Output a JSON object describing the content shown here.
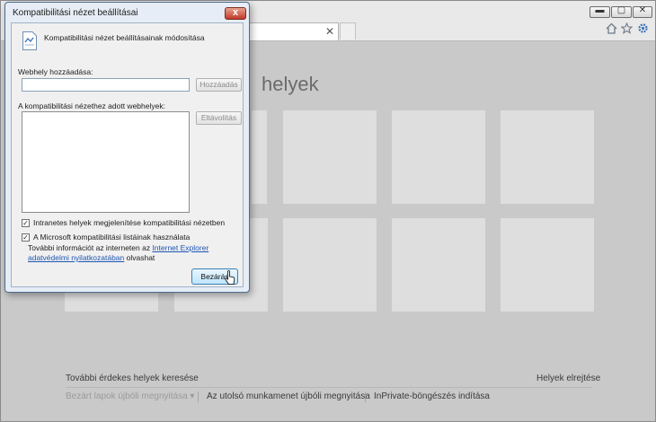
{
  "browser": {
    "window_buttons": {
      "minimize": "▬",
      "maximize": "▢",
      "close": "✕"
    },
    "tab_close": "✕",
    "toolbar_icons": [
      "home-icon",
      "star-icon",
      "gear-icon"
    ]
  },
  "newtab_page": {
    "heading": "helyek",
    "find_more": "További érdekes helyek keresése",
    "hide_sites": "Helyek elrejtése",
    "reopen_closed_tabs": "Bezárt lapok újbóli megnyitása",
    "reopen_closed_tabs_arrow": "▾",
    "reopen_last_session": "Az utolsó munkamenet újbóli megnyitása",
    "inprivate": "InPrivate-böngészés indítása"
  },
  "dialog": {
    "title": "Kompatibilitási nézet beállításai",
    "close_glyph": "x",
    "heading": "Kompatibilitási nézet beállításainak módosítása",
    "add_site_label": "Webhely hozzáadása:",
    "add_site_value": "",
    "add_button": "Hozzáadás",
    "list_label": "A kompatibilitási nézethez adott webhelyek:",
    "remove_button": "Eltávolítás",
    "checkbox_intranet": {
      "label": "Intranetes helyek megjelenítése kompatibilitási nézetben",
      "checked": true
    },
    "checkbox_mslist": {
      "label": "A Microsoft kompatibilitási listáinak használata",
      "checked": true
    },
    "info_prefix": "További információt az interneten az ",
    "info_link": "Internet Explorer adatvédelmi nyilatkozatában",
    "info_suffix": " olvashat",
    "close_button": "Bezárás",
    "check_glyph": "✓"
  },
  "colors": {
    "accent": "#3a74b8",
    "link": "#1e56b3",
    "dialog_close": "#c0392b"
  }
}
